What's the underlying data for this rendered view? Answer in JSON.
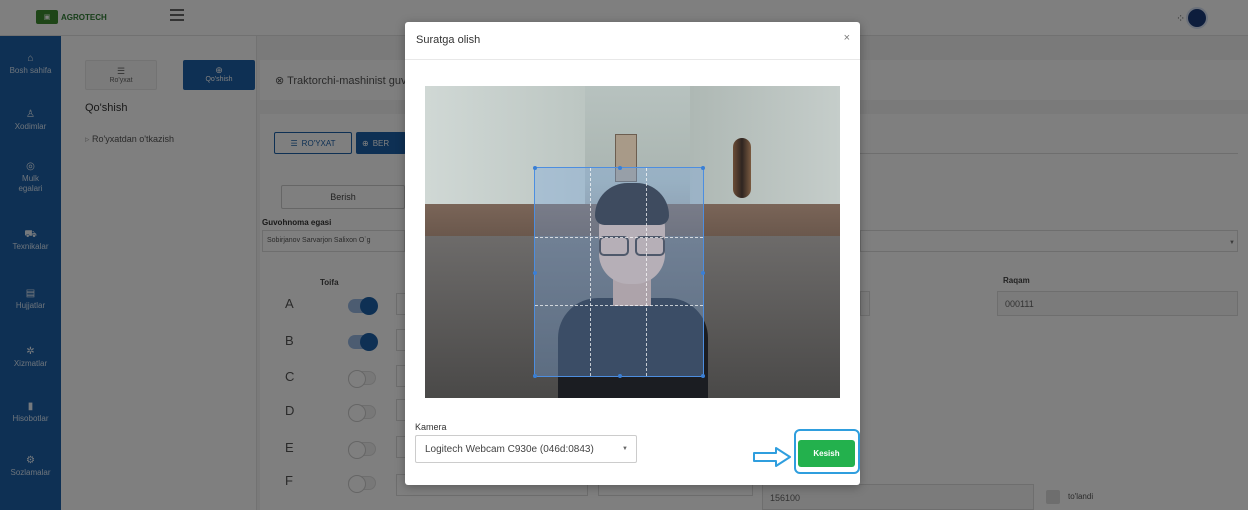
{
  "topbar": {
    "logo_text": "AGROTECH",
    "logo_icon": "tractor-icon"
  },
  "sidebar": {
    "items": [
      {
        "label": "Bosh sahifa",
        "icon": "home-icon"
      },
      {
        "label": "Xodimlar",
        "icon": "user-icon"
      },
      {
        "label": "Mulk egalari",
        "icon": "owner-icon"
      },
      {
        "label": "Texnikalar",
        "icon": "truck-icon"
      },
      {
        "label": "Hujjatlar",
        "icon": "document-icon"
      },
      {
        "label": "Xizmatlar",
        "icon": "services-icon"
      },
      {
        "label": "Hisobotlar",
        "icon": "report-icon"
      },
      {
        "label": "Sozlamalar",
        "icon": "gear-icon"
      }
    ],
    "color": "#1c61a8"
  },
  "subpanel": {
    "tab_list_label": "Ro'yxat",
    "tab_add_label": "Qo'shish",
    "heading": "Qo'shish",
    "link": "Ro'yxatdan o'tkazish"
  },
  "main": {
    "header_title": "Traktorchi-mashinist guv",
    "btn_list": "RO'YXAT",
    "btn_give": "BER",
    "btn_berish": "Berish",
    "owner_label": "Guvohnoma egasi",
    "owner_value": "Sobirjanov Sarvarjon Salixon O`g",
    "category_label": "Toifa",
    "categories": [
      {
        "letter": "A",
        "on": true
      },
      {
        "letter": "B",
        "on": true
      },
      {
        "letter": "C",
        "on": false
      },
      {
        "letter": "D",
        "on": false
      },
      {
        "letter": "E",
        "on": false
      },
      {
        "letter": "F",
        "on": false
      }
    ],
    "raqam_label": "Raqam",
    "raqam_value": "000111",
    "bottom_value": "156100",
    "paid_label": "to'landi"
  },
  "modal": {
    "title": "Suratga olish",
    "close": "×",
    "camera_label": "Kamera",
    "camera_value": "Logitech Webcam C930e (046d:0843)",
    "crop_button": "Kesish",
    "accent": "#23b14d",
    "highlight": "#2f9ede"
  }
}
